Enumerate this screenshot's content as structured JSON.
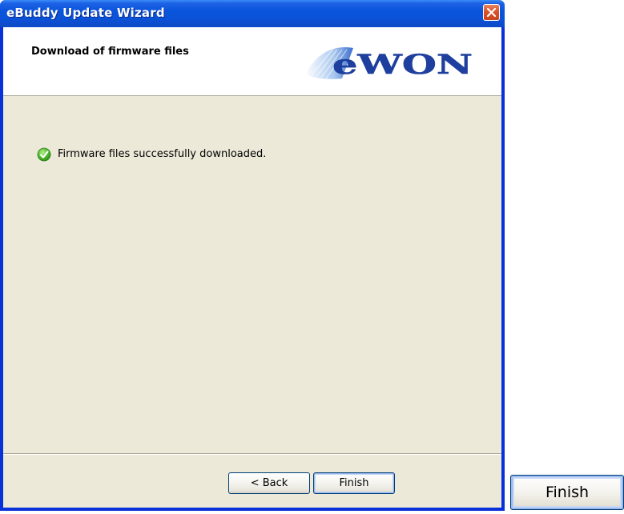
{
  "window": {
    "title": "eBuddy Update Wizard"
  },
  "header": {
    "title": "Download of firmware files",
    "logo_text": "eWON"
  },
  "content": {
    "status_icon": "check-circle-icon",
    "status_message": "Firmware files successfully downloaded."
  },
  "buttons": {
    "back_label": "< Back",
    "finish_label": "Finish"
  },
  "zoom_callout": {
    "finish_label": "Finish"
  },
  "colors": {
    "titlebar": "#0a55dc",
    "dialog_body": "#ece9d8",
    "success_green": "#3aa81f",
    "logo_blue": "#1f3f9e"
  }
}
